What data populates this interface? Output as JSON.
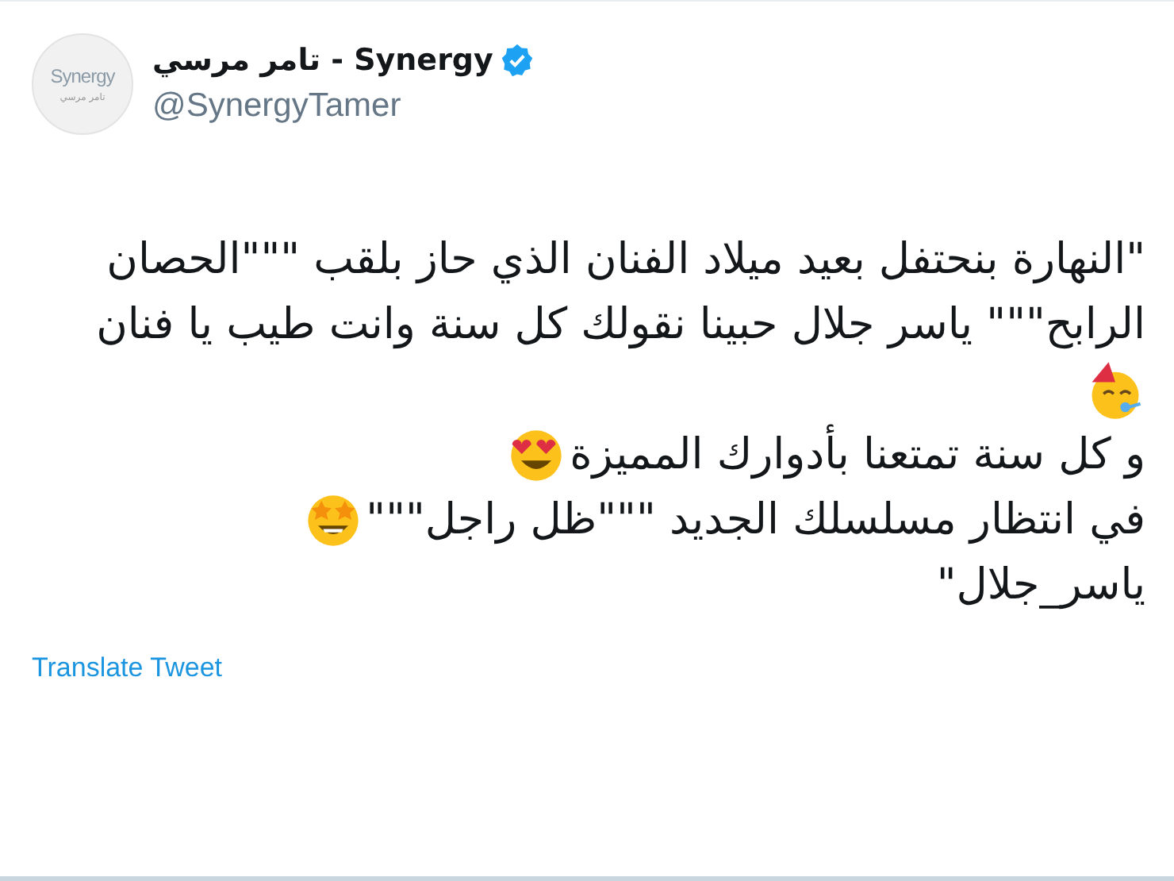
{
  "author": {
    "avatar": {
      "logo_text": "Synergy",
      "subtext": "تامر مرسي"
    },
    "name": "تامر مرسي - Synergy",
    "verified": true,
    "handle": "@SynergyTamer"
  },
  "tweet_lines": [
    {
      "text": "\"النهارة بنحتفل  بعيد ميلاد الفنان الذي حاز بلقب \"\"\"الحصان"
    },
    {
      "text": "الرابح\"\"\" ياسر جلال حبينا نقولك كل سنة وانت طيب يا فنان"
    },
    {
      "emoji": {
        "kind": "party"
      }
    },
    {
      "text": "و كل سنة تمتعنا بأدوارك المميزة",
      "emoji": {
        "kind": "heart_eyes"
      }
    },
    {
      "text": "في انتظار مسلسلك الجديد \"\"\"ظل راجل\"\"\"",
      "emoji": {
        "kind": "star_eyes"
      }
    },
    {
      "text": "ياسر_جلال\""
    }
  ],
  "translate_link": "Translate Tweet"
}
